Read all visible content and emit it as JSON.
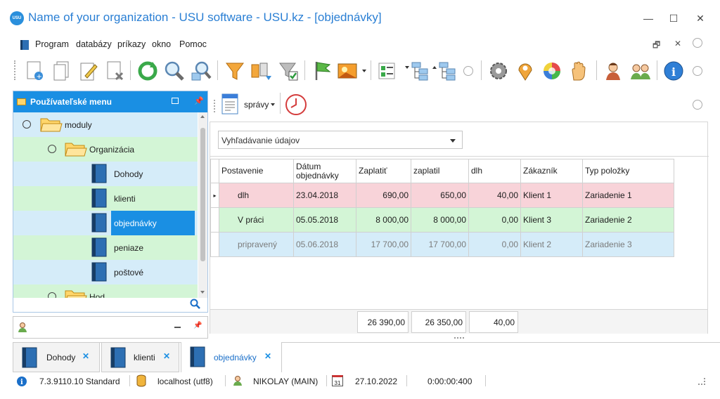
{
  "window": {
    "title": "Name of your organization - USU software - USU.kz - [objednávky]",
    "logo_text": "USU",
    "minimize": "—",
    "maximize": "☐",
    "close": "✕"
  },
  "menu": {
    "items": [
      "Program",
      "databázy",
      "príkazy",
      "okno",
      "Pomoc"
    ],
    "restore": "🗗",
    "close": "✕"
  },
  "sidebar": {
    "title": "Používateľské menu",
    "tree": [
      {
        "label": "moduly",
        "level": 0,
        "type": "folder"
      },
      {
        "label": "Organizácia",
        "level": 1,
        "type": "folder"
      },
      {
        "label": "Dohody",
        "level": 2,
        "type": "book"
      },
      {
        "label": "klienti",
        "level": 2,
        "type": "book"
      },
      {
        "label": "objednávky",
        "level": 2,
        "type": "book",
        "selected": true
      },
      {
        "label": "peniaze",
        "level": 2,
        "type": "book"
      },
      {
        "label": "poštové",
        "level": 2,
        "type": "book"
      },
      {
        "label": "Hod...",
        "level": 1,
        "type": "folder"
      }
    ]
  },
  "content": {
    "reports_button": "správy",
    "search_placeholder": "Vyhľadávanie údajov",
    "columns": [
      "Postavenie",
      "Dátum objednávky",
      "Zaplatiť",
      "zaplatil",
      "dlh",
      "Zákazník",
      "Typ položky"
    ],
    "rows": [
      {
        "status": "dlh",
        "date": "23.04.2018",
        "to_pay": "690,00",
        "paid": "650,00",
        "debt": "40,00",
        "customer": "Klient 1",
        "item_type": "Zariadenie 1",
        "color": "#f8d3d9",
        "text": "#1e1e1e"
      },
      {
        "status": "V práci",
        "date": "05.05.2018",
        "to_pay": "8 000,00",
        "paid": "8 000,00",
        "debt": "0,00",
        "customer": "Klient 3",
        "item_type": "Zariadenie 2",
        "color": "#d3f5d6",
        "text": "#1e1e1e"
      },
      {
        "status": "pripravený",
        "date": "05.06.2018",
        "to_pay": "17 700,00",
        "paid": "17 700,00",
        "debt": "0,00",
        "customer": "Klient 2",
        "item_type": "Zariadenie 3",
        "color": "#d5ecf9",
        "text": "#7b7b7b"
      }
    ],
    "totals": {
      "to_pay": "26 390,00",
      "paid": "26 350,00",
      "debt": "40,00"
    }
  },
  "tabs": [
    {
      "label": "Dohody",
      "active": false
    },
    {
      "label": "klienti",
      "active": false
    },
    {
      "label": "objednávky",
      "active": true
    }
  ],
  "status": {
    "version": "7.3.9110.10 Standard",
    "db": "localhost (utf8)",
    "user": "NIKOLAY (MAIN)",
    "calendar_day": "31",
    "date": "27.10.2022",
    "timer": "0:00:00:400"
  },
  "colors": {
    "accent": "#1a8fe3",
    "selected": "#1a8fe3",
    "tree_blue": "#d5ecf9",
    "tree_green": "#d3f5d6"
  }
}
